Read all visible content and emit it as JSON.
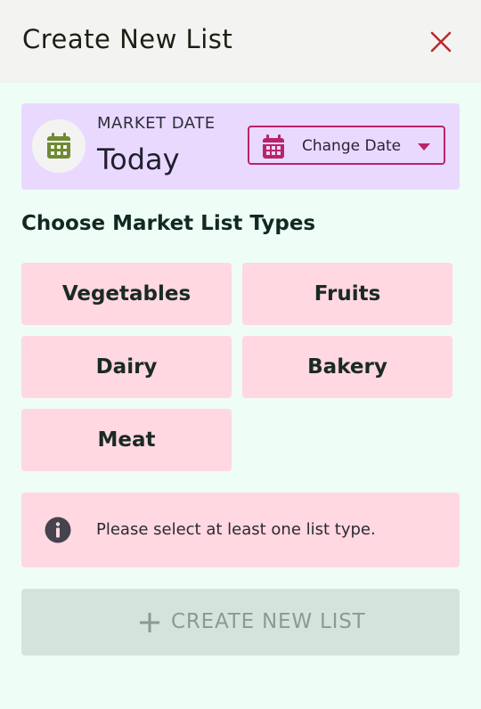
{
  "header": {
    "title": "Create New List",
    "close_icon": "close-icon",
    "close_color": "#c0282f"
  },
  "market_date": {
    "label": "MARKET DATE",
    "value": "Today",
    "icon": "calendar-icon",
    "icon_color": "#6f8a32",
    "change_button": {
      "label": "Change Date",
      "icon": "calendar-icon",
      "caret": "caret-down-icon",
      "accent": "#b8246a"
    }
  },
  "section": {
    "title": "Choose Market List Types"
  },
  "list_types": [
    {
      "label": "Vegetables"
    },
    {
      "label": "Fruits"
    },
    {
      "label": "Dairy"
    },
    {
      "label": "Bakery"
    },
    {
      "label": "Meat"
    }
  ],
  "notice": {
    "icon": "info-icon",
    "text": "Please select at least one list type."
  },
  "create_button": {
    "icon": "plus-icon",
    "label": "CREATE NEW LIST",
    "disabled": true
  },
  "colors": {
    "background": "#effdf7",
    "header_bg": "#f3f4f2",
    "date_card_bg": "#e9d9ff",
    "chip_bg": "#ffd8e2",
    "disabled_button_bg": "#d4e4dd"
  }
}
